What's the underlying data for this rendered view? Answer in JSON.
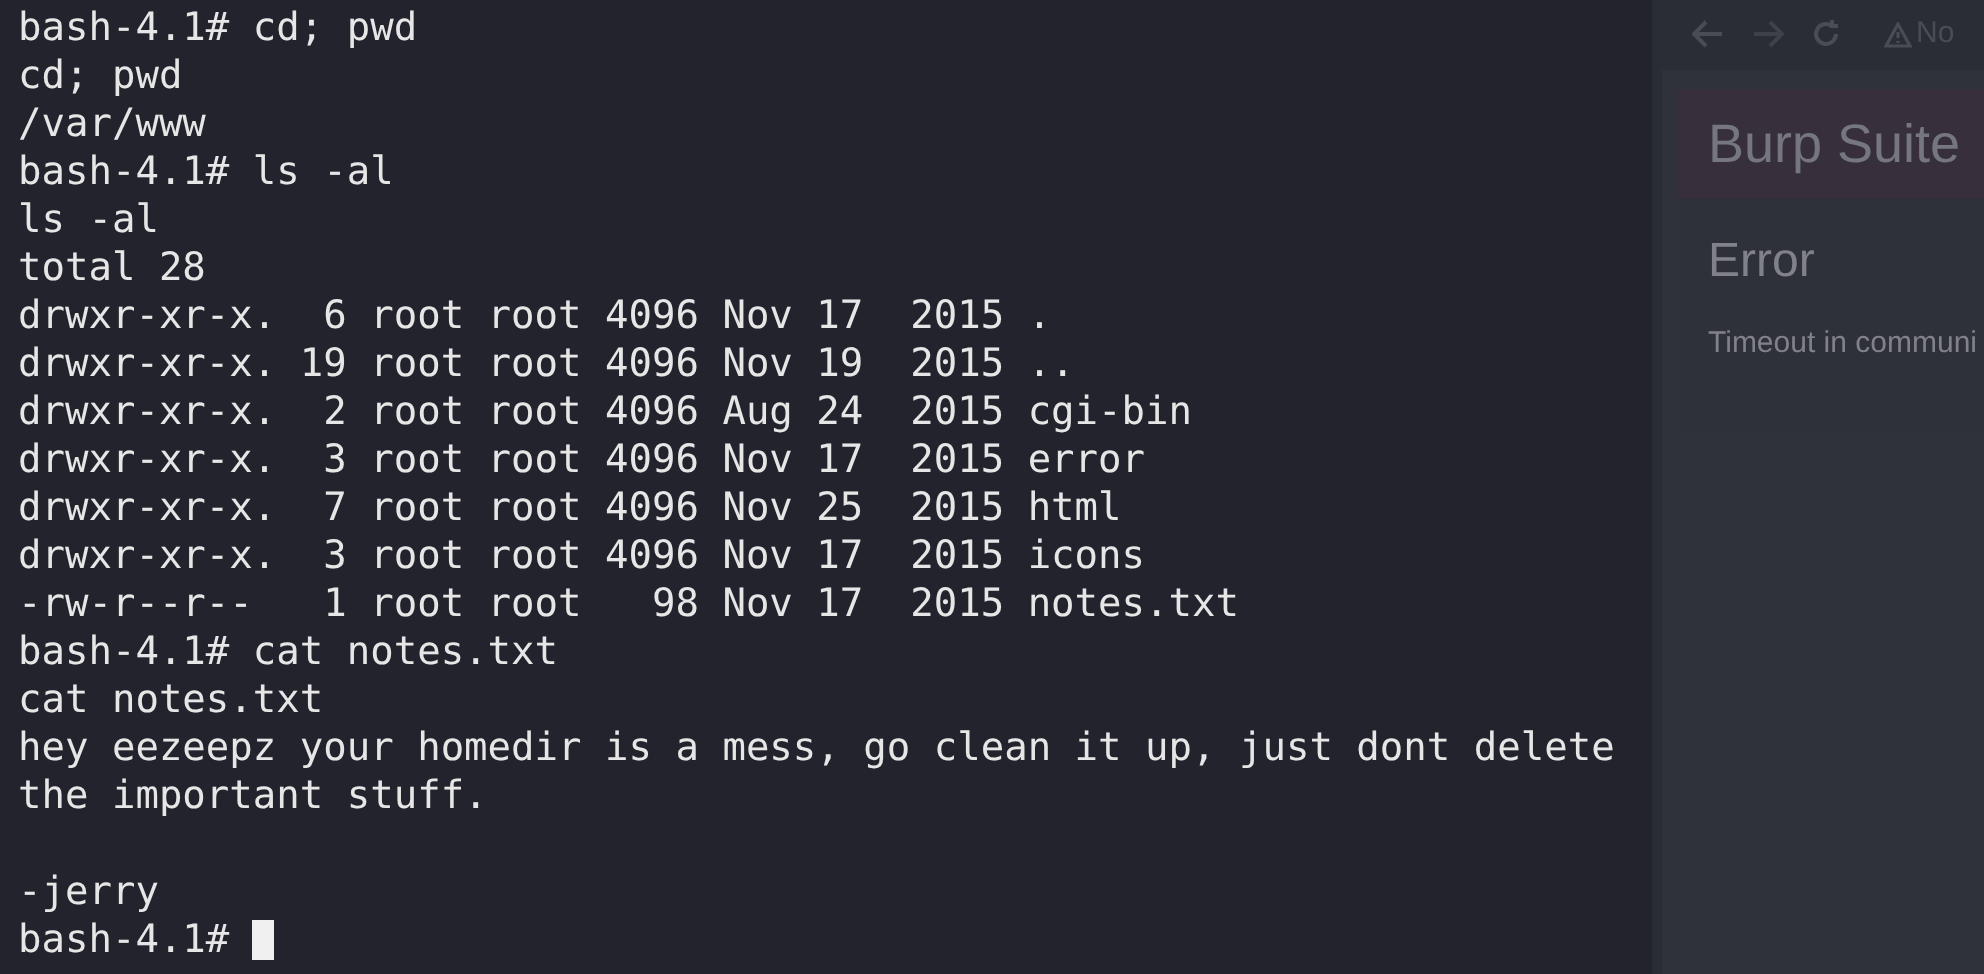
{
  "terminal": {
    "lines": [
      {
        "kind": "text",
        "text": "bash-4.1# cd; pwd"
      },
      {
        "kind": "text",
        "text": "cd; pwd"
      },
      {
        "kind": "text",
        "text": "/var/www"
      },
      {
        "kind": "text",
        "text": "bash-4.1# ls -al"
      },
      {
        "kind": "text",
        "text": "ls -al"
      },
      {
        "kind": "text",
        "text": "total 28"
      },
      {
        "kind": "text",
        "text": "drwxr-xr-x.  6 root root 4096 Nov 17  2015 ."
      },
      {
        "kind": "text",
        "text": "drwxr-xr-x. 19 root root 4096 Nov 19  2015 .."
      },
      {
        "kind": "text",
        "text": "drwxr-xr-x.  2 root root 4096 Aug 24  2015 cgi-bin"
      },
      {
        "kind": "text",
        "text": "drwxr-xr-x.  3 root root 4096 Nov 17  2015 error"
      },
      {
        "kind": "text",
        "text": "drwxr-xr-x.  7 root root 4096 Nov 25  2015 html"
      },
      {
        "kind": "text",
        "text": "drwxr-xr-x.  3 root root 4096 Nov 17  2015 icons"
      },
      {
        "kind": "text",
        "text": "-rw-r--r--   1 root root   98 Nov 17  2015 notes.txt"
      },
      {
        "kind": "text",
        "text": "bash-4.1# cat notes.txt"
      },
      {
        "kind": "text",
        "text": "cat notes.txt"
      },
      {
        "kind": "text",
        "text": "hey eezeepz your homedir is a mess, go clean it up, just dont delete"
      },
      {
        "kind": "text",
        "text": "the important stuff."
      },
      {
        "kind": "blank"
      },
      {
        "kind": "text",
        "text": "-jerry"
      }
    ],
    "prompt": "bash-4.1# "
  },
  "browser": {
    "address": "No",
    "banner": "Burp Suite",
    "heading": "Error",
    "message": "Timeout in communi"
  }
}
